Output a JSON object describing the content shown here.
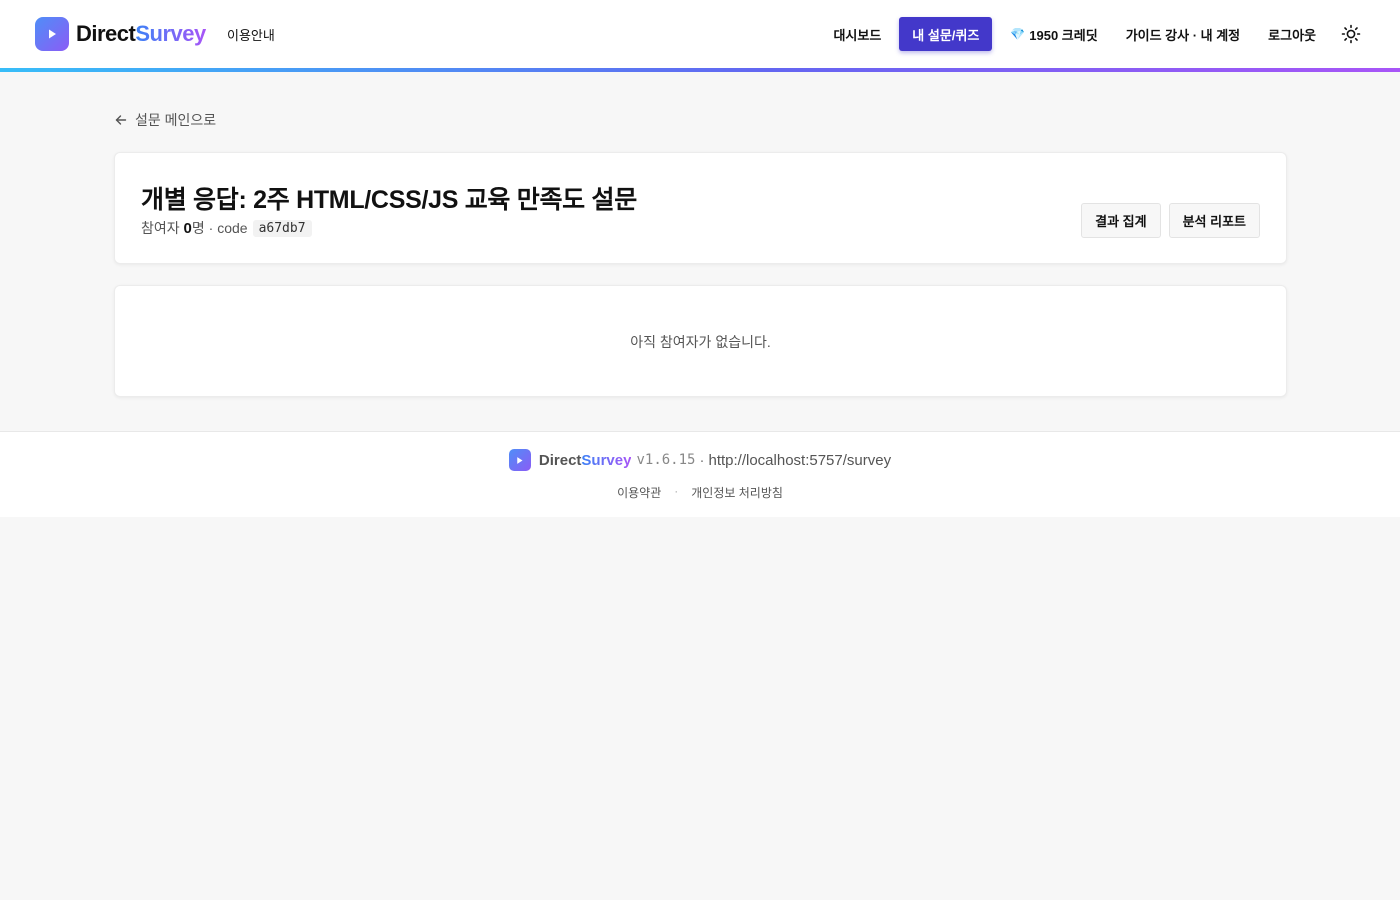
{
  "header": {
    "brand_direct": "Direct",
    "brand_survey": "Survey",
    "guide_label": "이용안내",
    "nav": {
      "dashboard": "대시보드",
      "my_surveys": "내 설문/퀴즈",
      "credits": "1950 크레딧",
      "account": "가이드 강사 · 내 계정",
      "logout": "로그아웃"
    },
    "theme_icon": "sun-icon",
    "accent_color": "#4338ca"
  },
  "main": {
    "back_label": "설문 메인으로",
    "title": "개별 응답: 2주 HTML/CSS/JS 교육 만족도 설문",
    "meta": {
      "participants_prefix": "참여자",
      "participants_count": "0",
      "participants_suffix": "명 · code",
      "code": "a67db7"
    },
    "buttons": {
      "aggregate": "결과 집계",
      "report": "분석 리포트"
    },
    "empty_message": "아직 참여자가 없습니다."
  },
  "footer": {
    "brand_direct": "Direct",
    "brand_survey": "Survey",
    "version": "v1.6.15",
    "url": "http://localhost:5757/survey",
    "terms": "이용약관",
    "privacy": "개인정보 처리방침"
  }
}
